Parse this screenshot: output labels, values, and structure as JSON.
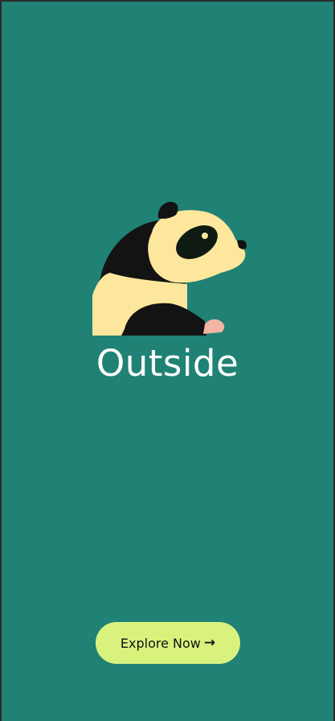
{
  "app": {
    "title": "Outside"
  },
  "hero": {
    "illustration_icon": "panda-icon"
  },
  "cta": {
    "label": "Explore Now",
    "icon": "arrow-right-icon",
    "icon_glyph": "→"
  },
  "colors": {
    "background": "#1f8275",
    "button": "#d9f27e",
    "title_text": "#ffffff",
    "panda_fur": "#fde79c",
    "panda_black": "#131313"
  }
}
